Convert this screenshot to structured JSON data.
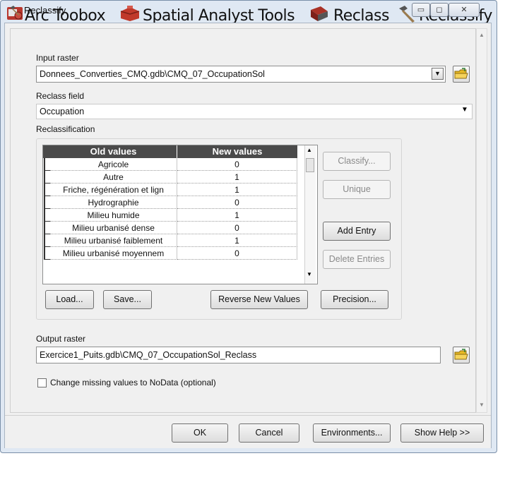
{
  "breadcrumb": {
    "items": [
      "Arc Toobox",
      "Spatial Analyst Tools",
      "Reclass",
      "Reclassify"
    ]
  },
  "window": {
    "title": "Reclassify",
    "controls": {
      "minimize": "▭",
      "maximize": "◻",
      "close": "✕"
    }
  },
  "input_raster": {
    "label": "Input raster",
    "value": "Donnees_Converties_CMQ.gdb\\CMQ_07_OccupationSol"
  },
  "reclass_field": {
    "label": "Reclass field",
    "value": "Occupation"
  },
  "reclassification": {
    "label": "Reclassification",
    "columns": [
      "Old values",
      "New values"
    ],
    "rows": [
      {
        "old": "Agricole",
        "new": "0"
      },
      {
        "old": "Autre",
        "new": "1"
      },
      {
        "old": "Friche, régénération et lign",
        "new": "1"
      },
      {
        "old": "Hydrographie",
        "new": "0"
      },
      {
        "old": "Milieu humide",
        "new": "1"
      },
      {
        "old": "Milieu urbanisé dense",
        "new": "0"
      },
      {
        "old": "Milieu urbanisé faiblement",
        "new": "1"
      },
      {
        "old": "Milieu urbanisé moyennem",
        "new": "0"
      }
    ],
    "side_buttons": {
      "classify": "Classify...",
      "unique": "Unique",
      "add_entry": "Add Entry",
      "delete_entries": "Delete Entries"
    },
    "bottom_buttons": {
      "load": "Load...",
      "save": "Save...",
      "reverse": "Reverse New Values",
      "precision": "Precision..."
    }
  },
  "output_raster": {
    "label": "Output raster",
    "value": "Exercice1_Puits.gdb\\CMQ_07_OccupationSol_Reclass"
  },
  "missing_values": {
    "label": "Change missing values to NoData (optional)",
    "checked": false
  },
  "footer": {
    "ok": "OK",
    "cancel": "Cancel",
    "environments": "Environments...",
    "show_help": "Show Help >>"
  }
}
